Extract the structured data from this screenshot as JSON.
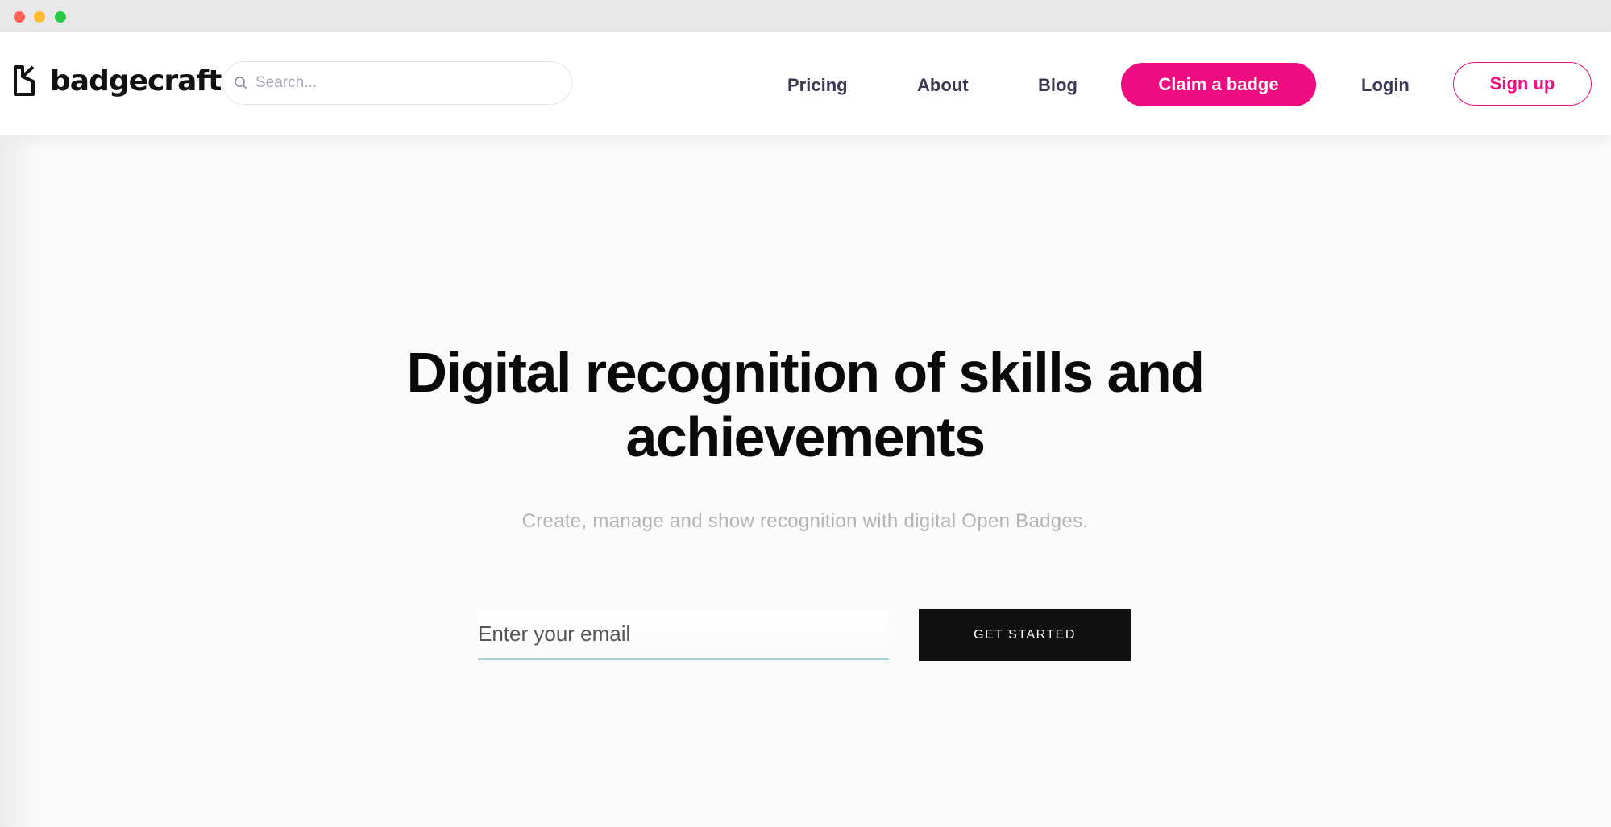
{
  "brand": {
    "name": "badgecraft",
    "accent_color": "#ef0b80"
  },
  "search": {
    "placeholder": "Search...",
    "icon": "search-icon"
  },
  "nav": {
    "items": [
      {
        "label": "Pricing"
      },
      {
        "label": "About"
      },
      {
        "label": "Blog"
      }
    ],
    "claim_label": "Claim a badge",
    "login_label": "Login",
    "signup_label": "Sign up"
  },
  "hero": {
    "title_line1": "Digital recognition of skills and",
    "title_line2": "achievements",
    "subtitle": "Create, manage and show recognition with digital Open Badges.",
    "email_placeholder": "Enter your email",
    "cta_label": "GET STARTED"
  }
}
